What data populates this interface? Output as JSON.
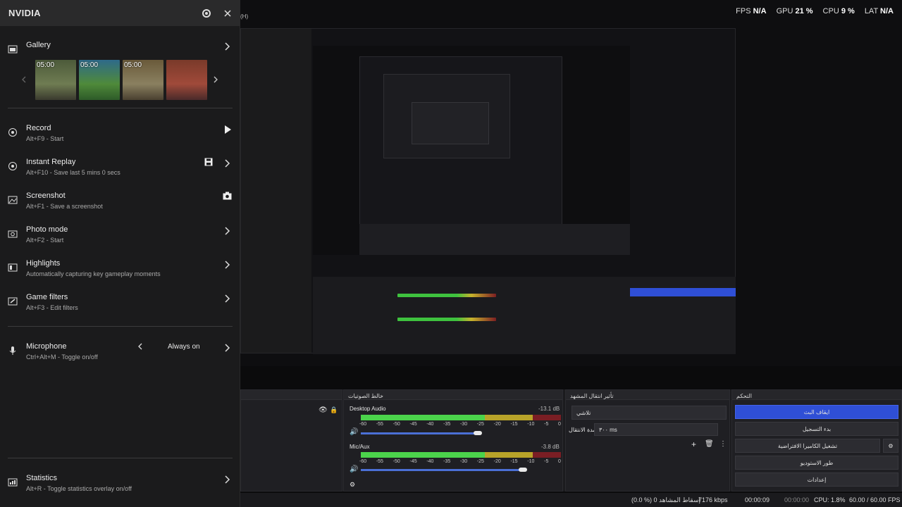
{
  "perf": {
    "fps_label": "FPS",
    "fps": "N/A",
    "gpu_label": "GPU",
    "gpu": "21 %",
    "cpu_label": "CPU",
    "cpu": "9 %",
    "lat_label": "LAT",
    "lat": "N/A"
  },
  "window_hint": "(H)",
  "nvidia": {
    "title": "NVIDIA",
    "gallery": {
      "label": "Gallery",
      "thumbs": [
        "05:00",
        "05:00",
        "05:00",
        ""
      ]
    },
    "items": [
      {
        "label": "Record",
        "desc": "Alt+F9 - Start"
      },
      {
        "label": "Instant Replay",
        "desc": "Alt+F10 - Save last 5 mins 0 secs"
      },
      {
        "label": "Screenshot",
        "desc": "Alt+F1 - Save a screenshot"
      },
      {
        "label": "Photo mode",
        "desc": "Alt+F2 - Start"
      },
      {
        "label": "Highlights",
        "desc": "Automatically capturing key gameplay moments"
      },
      {
        "label": "Game filters",
        "desc": "Alt+F3 - Edit filters"
      }
    ],
    "microphone": {
      "label": "Microphone",
      "desc": "Ctrl+Alt+M - Toggle on/off",
      "value": "Always on"
    },
    "statistics": {
      "label": "Statistics",
      "desc": "Alt+R - Toggle statistics overlay on/off"
    }
  },
  "obs": {
    "mixer_title": "خالط الصوتيات",
    "transition_title": "تأثير انتقال المشهد",
    "controls_title": "التحكم",
    "desktop_audio": {
      "label": "Desktop Audio",
      "db": "-13.1 dB"
    },
    "mic_aux": {
      "label": "Mic/Aux",
      "db": "-3.8 dB"
    },
    "meter_ticks": [
      "-60",
      "-55",
      "-50",
      "-45",
      "-40",
      "-35",
      "-30",
      "-25",
      "-20",
      "-15",
      "-10",
      "-5",
      "0"
    ],
    "transition_value": "تلاشي",
    "duration_label": "مدة الانتقال",
    "duration_value": "٣٠٠ ms",
    "buttons": [
      "ايقاف البث",
      "بدء التسجيل",
      "تشغيل الكاميرا الافتراضية",
      "طور الاستوديو",
      "إعدادات"
    ],
    "status": {
      "dropped": "(0.0 %) 0 إسقاط المشاهد",
      "kbps": "7176 kbps",
      "stream_time": "00:00:09",
      "rec_time": "00:00:00",
      "cpu": "CPU: 1.8%",
      "fps": "60.00 / 60.00 FPS"
    }
  },
  "colors": {
    "accent": "#2f4fd6",
    "panel": "#1b1b1c",
    "header": "#2a2a2b"
  }
}
